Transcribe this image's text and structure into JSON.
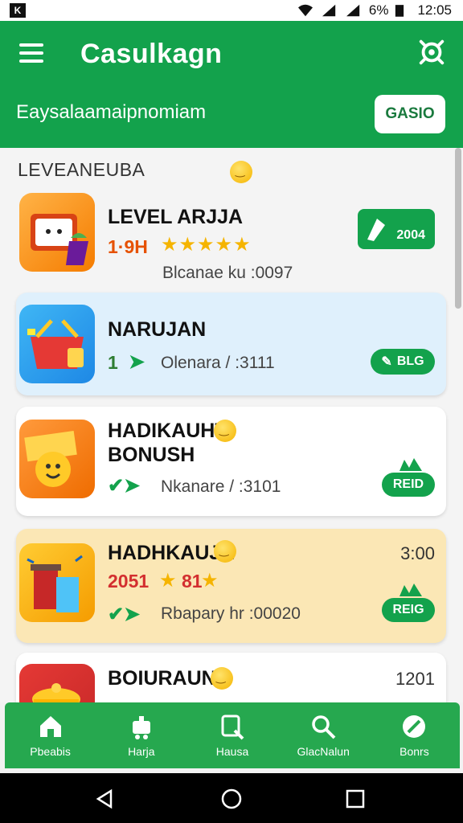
{
  "status_bar": {
    "left_icon": "K",
    "battery": "6%",
    "time": "12:05"
  },
  "app_bar": {
    "title": "Casulkagn",
    "subtitle": "Eaysalaamaipnomiam",
    "action_button": "GASIO"
  },
  "section": {
    "heading": "LEVEANEUBA"
  },
  "cards": [
    {
      "title": "LEVEL ARJJA",
      "number": "1·9H",
      "sub": "Blcanae ku :0097",
      "badge": "2004"
    },
    {
      "title": "NARUJAN",
      "number": "1",
      "sub": "Olenara / :3111",
      "badge": "BLG"
    },
    {
      "title_line1": "HADIKAUHT",
      "title_line2": "BONUSH",
      "sub": "Nkanare / :3101",
      "badge": "REID"
    },
    {
      "title": "HADHKAUJN",
      "number": "2051",
      "number_extra": "81",
      "sub": "Rbapary hr :00020",
      "right": "3:00",
      "badge": "REIG"
    },
    {
      "title": "BOIURAUNN",
      "right": "1201"
    }
  ],
  "bottom_nav": [
    "Pbeabis",
    "Harja",
    "Hausa",
    "GlacNalun",
    "Bonrs"
  ],
  "colors": {
    "primary": "#13a24c",
    "blue_card": "#dff0fc",
    "yellow_card": "#fbe7b5"
  }
}
